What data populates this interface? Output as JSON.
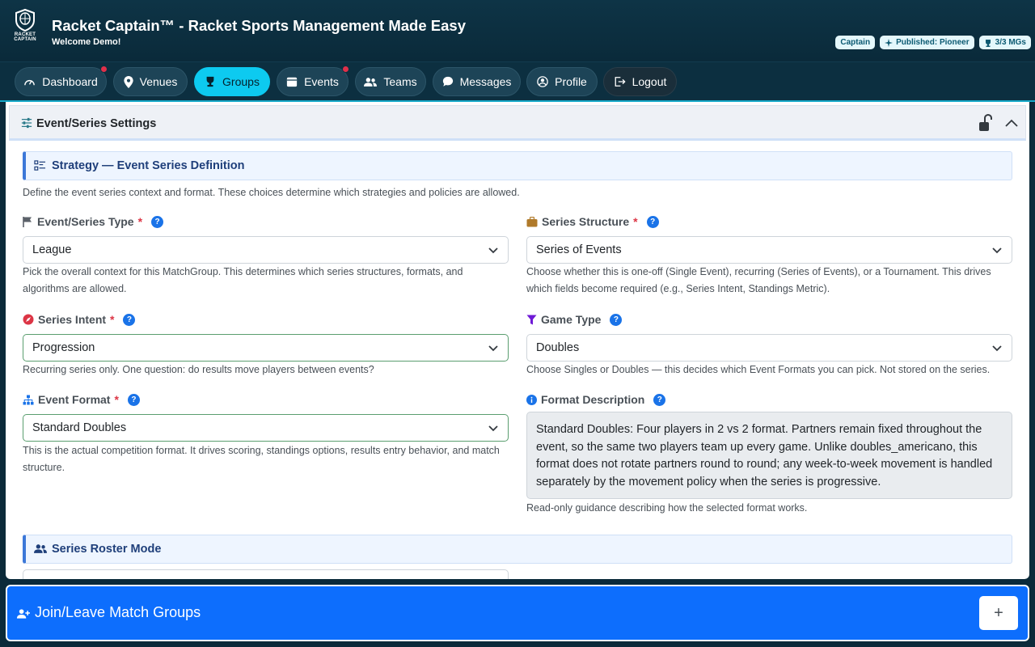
{
  "app": {
    "title": "Racket Captain™ - Racket Sports Management Made Easy",
    "welcome": "Welcome Demo!",
    "logo_text_1": "RACKET",
    "logo_text_2": "CAPTAIN"
  },
  "badges": {
    "role": "Captain",
    "published": "Published: Pioneer",
    "mgs": "3/3 MGs"
  },
  "nav": {
    "dashboard": "Dashboard",
    "venues": "Venues",
    "groups": "Groups",
    "events": "Events",
    "teams": "Teams",
    "messages": "Messages",
    "profile": "Profile",
    "logout": "Logout",
    "active": "Groups"
  },
  "settings": {
    "title": "Event/Series Settings"
  },
  "strategy": {
    "title": "Strategy — Event Series Definition",
    "description": "Define the event series context and format. These choices determine which strategies and policies are allowed."
  },
  "fields": {
    "event_series_type": {
      "label": "Event/Series Type",
      "value": "League",
      "help": "Pick the overall context for this MatchGroup. This determines which series structures, formats, and algorithms are allowed."
    },
    "series_structure": {
      "label": "Series Structure",
      "value": "Series of Events",
      "help": "Choose whether this is one-off (Single Event), recurring (Series of Events), or a Tournament. This drives which fields become required (e.g., Series Intent, Standings Metric)."
    },
    "series_intent": {
      "label": "Series Intent",
      "value": "Progression",
      "help": "Recurring series only. One question: do results move players between events?"
    },
    "game_type": {
      "label": "Game Type",
      "value": "Doubles",
      "help": "Choose Singles or Doubles — this decides which Event Formats you can pick. Not stored on the series."
    },
    "event_format": {
      "label": "Event Format",
      "value": "Standard Doubles",
      "help": "This is the actual competition format. It drives scoring, standings options, results entry behavior, and match structure."
    },
    "format_description": {
      "label": "Format Description",
      "value": "Standard Doubles: Four players in 2 vs 2 format. Partners remain fixed throughout the event, so the same two players team up every game. Unlike doubles_americano, this format does not rotate partners round to round; any week-to-week movement is handled separately by the movement policy when the series is progressive.",
      "help": "Read-only guidance describing how the selected format works."
    },
    "required_mark": "*",
    "help_mark": "?"
  },
  "roster": {
    "title": "Series Roster Mode"
  },
  "join": {
    "title": "Join/Leave Match Groups",
    "plus": "+"
  },
  "colors": {
    "header_bg": "#0e3446",
    "nav_active": "#0dcaf0",
    "join_bg": "#0d6efd",
    "section_accent": "#3c78d8",
    "required": "#dc3545",
    "help_icon": "#1a73e8"
  }
}
